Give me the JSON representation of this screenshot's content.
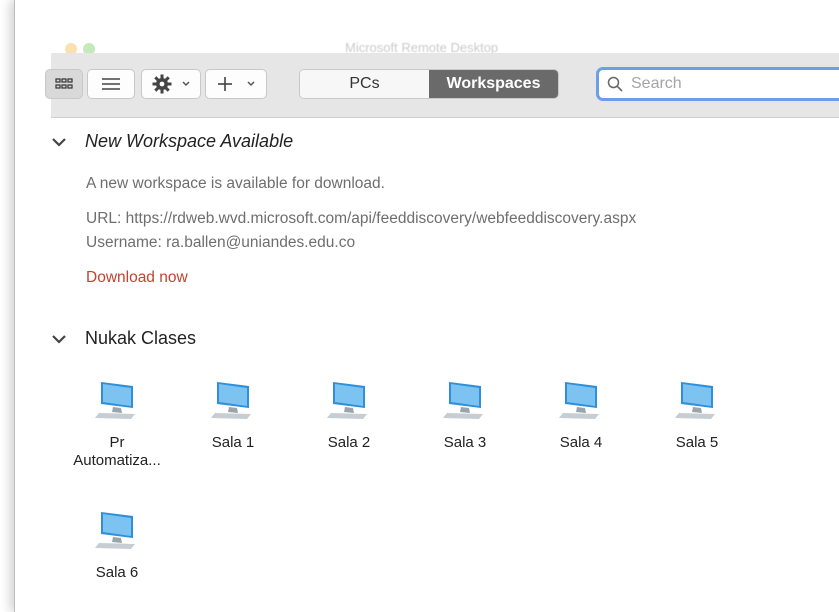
{
  "window": {
    "title": "Microsoft Remote Desktop"
  },
  "toolbar": {
    "view_grid_icon": "grid-view-icon",
    "view_list_icon": "list-view-icon",
    "settings_icon": "gear-icon",
    "add_icon": "plus-icon",
    "tabs": [
      {
        "label": "PCs",
        "selected": false
      },
      {
        "label": "Workspaces",
        "selected": true
      }
    ],
    "search_placeholder": "Search"
  },
  "new_workspace": {
    "heading": "New Workspace Available",
    "description": "A new workspace is available for download.",
    "url_line": "URL: https://rdweb.wvd.microsoft.com/api/feeddiscovery/webfeeddiscovery.aspx",
    "username_line": "Username: ra.ballen@uniandes.edu.co",
    "download_label": "Download now"
  },
  "workspace_group": {
    "heading": "Nukak Clases",
    "pcs": [
      {
        "name": "Pr\nAutomatiza..."
      },
      {
        "name": "Sala 1"
      },
      {
        "name": "Sala 2"
      },
      {
        "name": "Sala 3"
      },
      {
        "name": "Sala 4"
      },
      {
        "name": "Sala 5"
      },
      {
        "name": "Sala 6"
      }
    ]
  },
  "colors": {
    "accent_link": "#c2432f",
    "search_focus": "#6d9ee8",
    "selected_tab": "#6a6a6a"
  }
}
